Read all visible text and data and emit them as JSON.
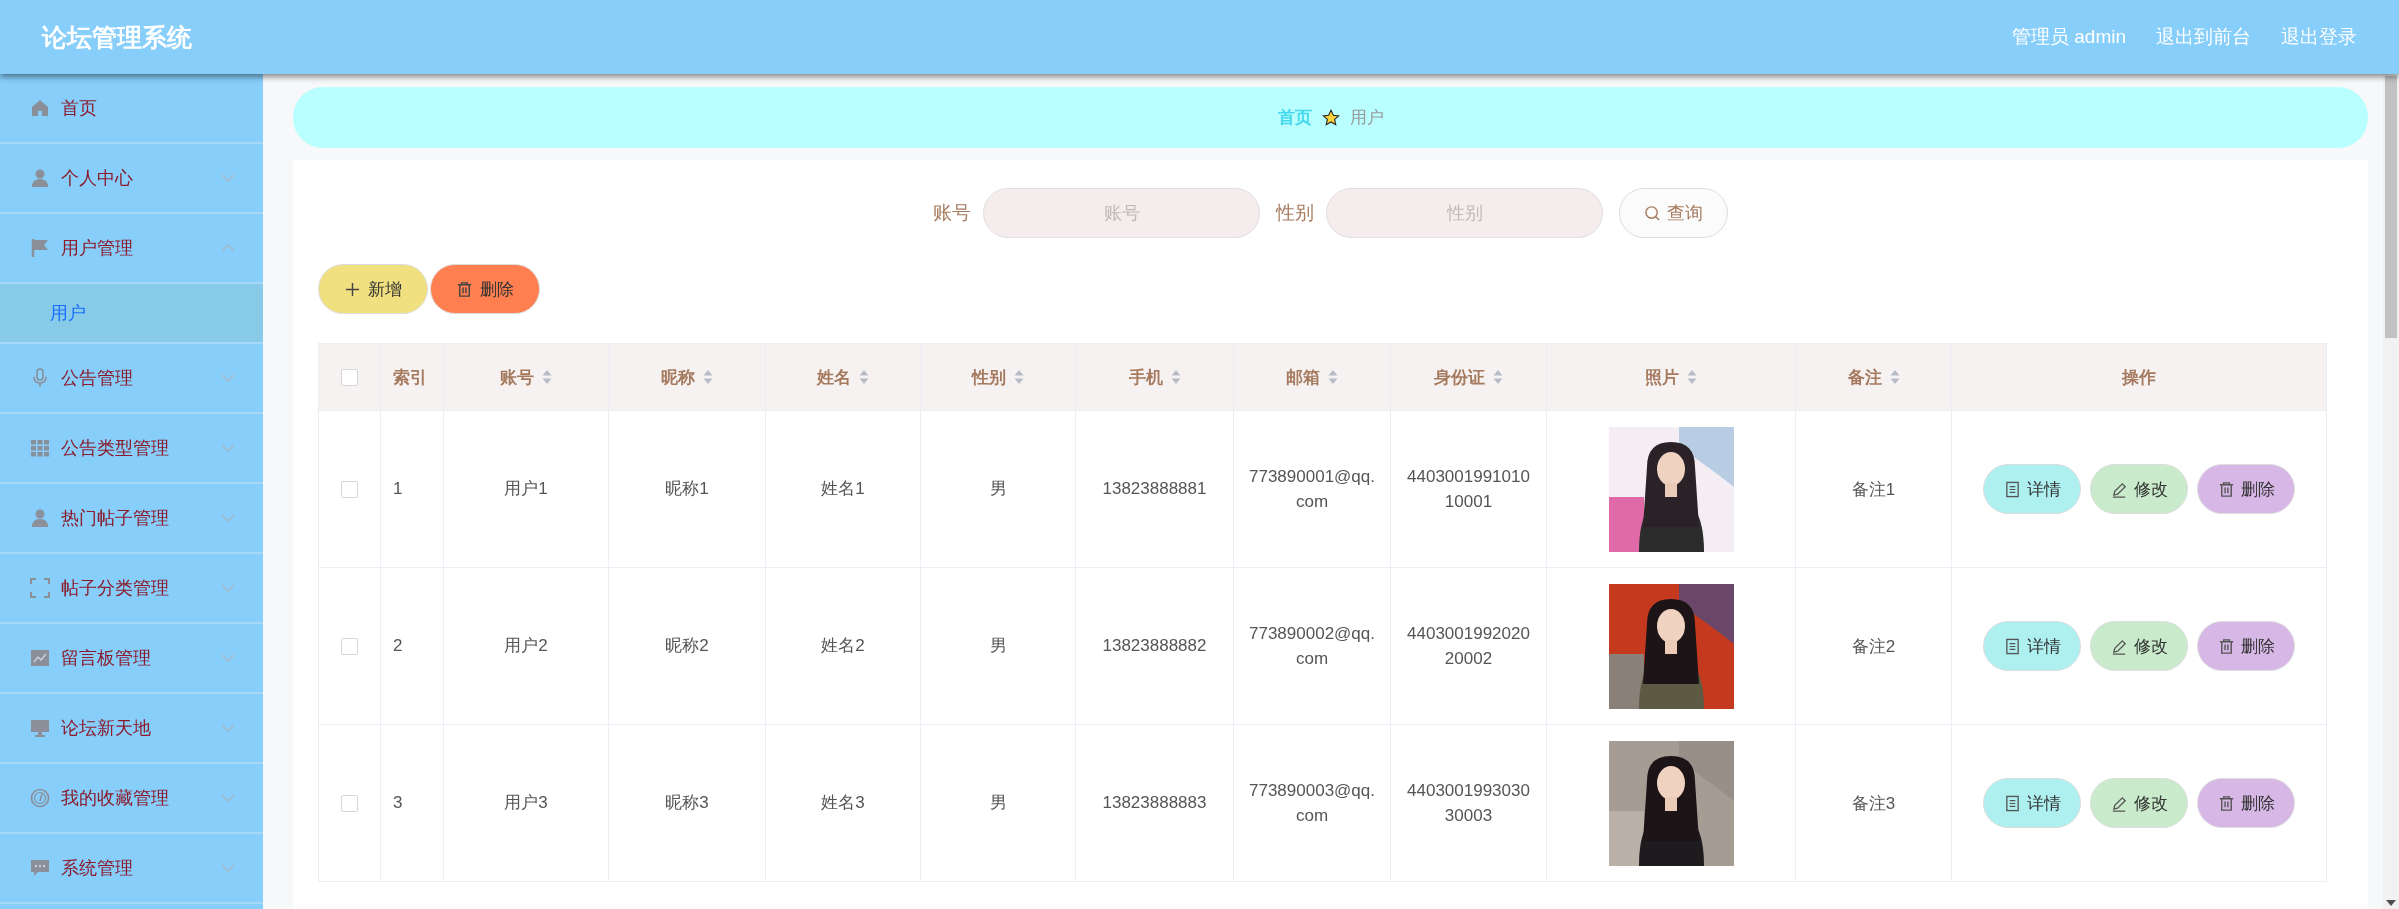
{
  "header": {
    "title": "论坛管理系统",
    "links": [
      "管理员 admin",
      "退出到前台",
      "退出登录"
    ]
  },
  "sidebar": {
    "items": [
      {
        "label": "首页",
        "selected": false
      },
      {
        "label": "个人中心",
        "selected": false,
        "expanded": false
      },
      {
        "label": "用户管理",
        "selected": false,
        "expanded": true,
        "children": [
          {
            "label": "用户",
            "selected": true
          }
        ]
      },
      {
        "label": "公告管理",
        "selected": false,
        "expanded": false
      },
      {
        "label": "公告类型管理",
        "selected": false,
        "expanded": false
      },
      {
        "label": "热门帖子管理",
        "selected": false,
        "expanded": false
      },
      {
        "label": "帖子分类管理",
        "selected": false,
        "expanded": false
      },
      {
        "label": "留言板管理",
        "selected": false,
        "expanded": false
      },
      {
        "label": "论坛新天地",
        "selected": false,
        "expanded": false
      },
      {
        "label": "我的收藏管理",
        "selected": false,
        "expanded": false
      },
      {
        "label": "系统管理",
        "selected": false,
        "expanded": false
      }
    ]
  },
  "breadcrumb": [
    "首页",
    "用户"
  ],
  "search": {
    "fields": [
      {
        "label": "账号",
        "placeholder": "账号"
      },
      {
        "label": "性别",
        "placeholder": "性别"
      }
    ],
    "button": "查询"
  },
  "toolbar": [
    {
      "kind": "add",
      "label": "新增"
    },
    {
      "kind": "delete",
      "label": "删除"
    }
  ],
  "table": {
    "select_all": {
      "checked": false
    },
    "columns": [
      {
        "label": "索引",
        "sortable": false
      },
      {
        "label": "账号",
        "sortable": true
      },
      {
        "label": "昵称",
        "sortable": true
      },
      {
        "label": "姓名",
        "sortable": true
      },
      {
        "label": "性别",
        "sortable": true
      },
      {
        "label": "手机",
        "sortable": true
      },
      {
        "label": "邮箱",
        "sortable": true
      },
      {
        "label": "身份证",
        "sortable": true
      },
      {
        "label": "照片",
        "sortable": true
      },
      {
        "label": "备注",
        "sortable": true
      },
      {
        "label": "操作",
        "sortable": false
      }
    ],
    "rows": [
      {
        "checked": false,
        "cells": [
          "1",
          "用户1",
          "昵称1",
          "姓名1",
          "男",
          "13823888881",
          "773890001@qq.com",
          "440300199101010001"
        ],
        "remark": "备注1",
        "actions": [
          {
            "kind": "detail",
            "label": "详情"
          },
          {
            "kind": "edit",
            "label": "修改"
          },
          {
            "kind": "delete",
            "label": "删除"
          }
        ]
      },
      {
        "checked": false,
        "cells": [
          "2",
          "用户2",
          "昵称2",
          "姓名2",
          "男",
          "13823888882",
          "773890002@qq.com",
          "440300199202020002"
        ],
        "remark": "备注2",
        "actions": [
          {
            "kind": "detail",
            "label": "详情"
          },
          {
            "kind": "edit",
            "label": "修改"
          },
          {
            "kind": "delete",
            "label": "删除"
          }
        ]
      },
      {
        "checked": false,
        "cells": [
          "3",
          "用户3",
          "昵称3",
          "姓名3",
          "男",
          "13823888883",
          "773890003@qq.com",
          "440300199303030003"
        ],
        "remark": "备注3",
        "actions": [
          {
            "kind": "detail",
            "label": "详情"
          },
          {
            "kind": "edit",
            "label": "修改"
          },
          {
            "kind": "delete",
            "label": "删除"
          }
        ]
      }
    ]
  }
}
